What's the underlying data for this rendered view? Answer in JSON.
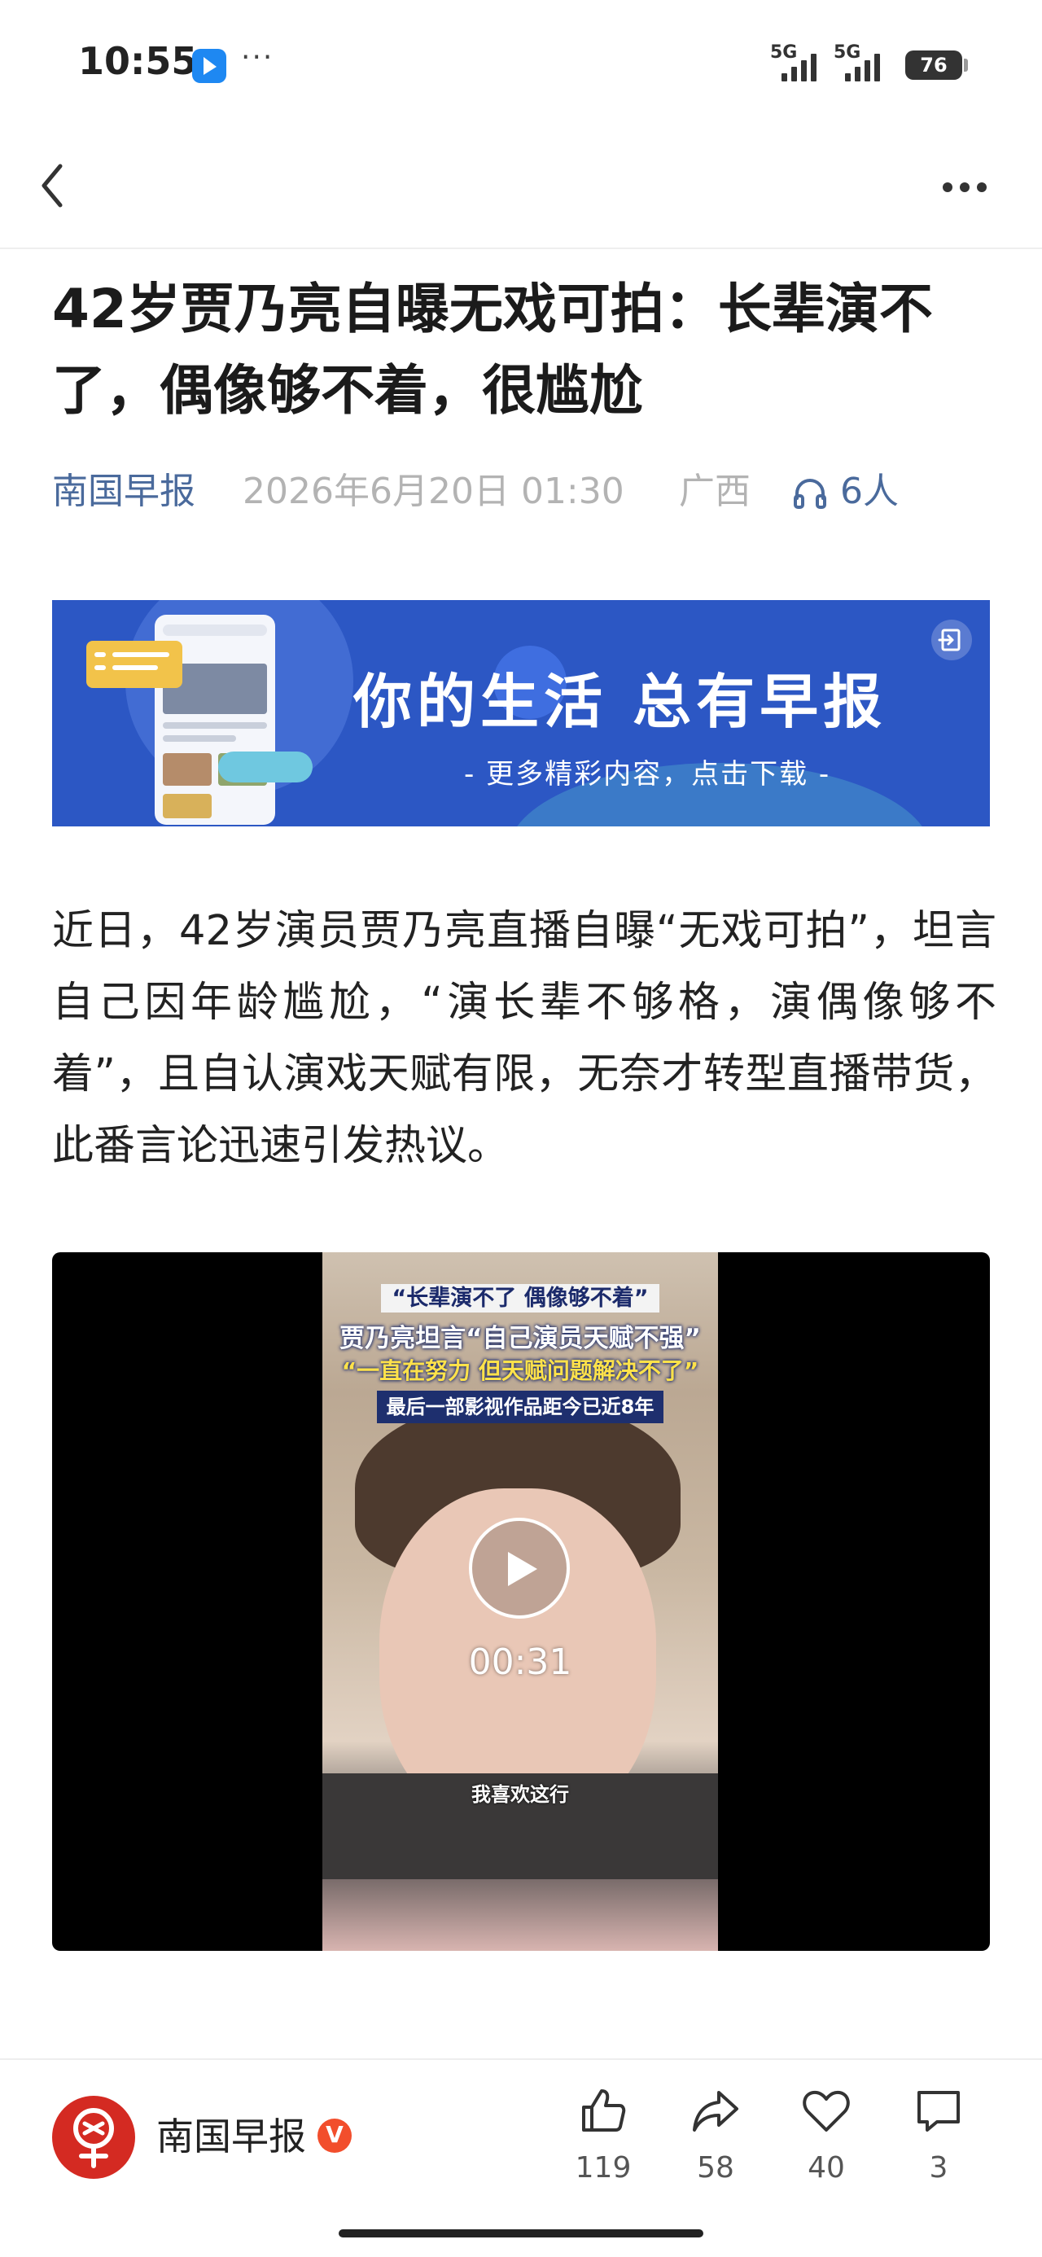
{
  "status_bar": {
    "time": "10:55",
    "more": "···",
    "signal1": "5G",
    "signal2": "5G",
    "battery": "76"
  },
  "article": {
    "title": "42岁贾乃亮自曝无戏可拍：长辈演不了，偶像够不着，很尴尬",
    "source": "南国早报",
    "date": "2026年6月20日 01:30",
    "region": "广西",
    "listeners": "6人",
    "paragraph": "近日，42岁演员贾乃亮直播自曝“无戏可拍”，坦言自己因年龄尴尬，“演长辈不够格，演偶像够不着”，且自认演戏天赋有限，无奈才转型直播带货，此番言论迅速引发热议。"
  },
  "banner": {
    "headline": "你的生活 总有早报",
    "subtitle": "- 更多精彩内容，点击下载 -"
  },
  "video": {
    "caption1": "“长辈演不了 偶像够不着”",
    "caption2": "贾乃亮坦言“自己演员天赋不强”",
    "caption3": "“一直在努力 但天赋问题解决不了”",
    "caption4": "最后一部影视作品距今已近8年",
    "subtitle": "我喜欢这行",
    "duration": "00:31"
  },
  "footer": {
    "publisher": "南国早报",
    "verified_badge": "V",
    "likes": "119",
    "shares": "58",
    "favorites": "40",
    "comments": "3"
  },
  "colors": {
    "source_blue": "#4a6a9c",
    "banner_blue": "#2c57c4",
    "avatar_red": "#d42a22",
    "verified_orange": "#f24e2c"
  }
}
